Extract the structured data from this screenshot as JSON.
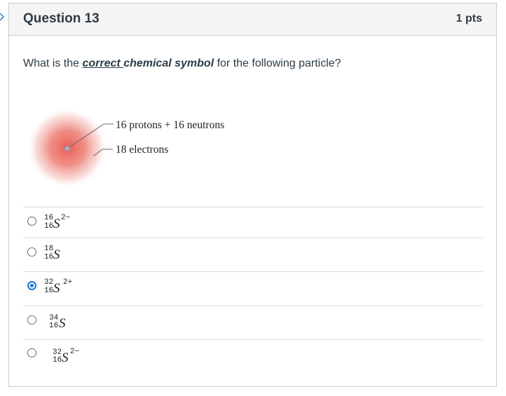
{
  "question": {
    "title": "Question 13",
    "points": "1 pts",
    "prompt_before": "What is the ",
    "prompt_emph_underlined": "correct ",
    "prompt_emph": "chemical symbol",
    "prompt_after": " for the following particle?"
  },
  "figure": {
    "label_nucleus": "16 protons + 16 neutrons",
    "label_electrons": "18 electrons",
    "cloud_color": "#e8564c"
  },
  "answers": [
    {
      "mass": "16",
      "atomic": "16",
      "symbol": "S",
      "charge": "2−",
      "selected": false
    },
    {
      "mass": "18",
      "atomic": "16",
      "symbol": "S",
      "charge": "",
      "selected": false
    },
    {
      "mass": "32",
      "atomic": "16",
      "symbol": "S",
      "charge": "2+",
      "selected": true
    },
    {
      "mass": "34",
      "atomic": "16",
      "symbol": "S",
      "charge": "",
      "selected": false
    },
    {
      "mass": "32",
      "atomic": "16",
      "symbol": "S",
      "charge": "2−",
      "selected": false
    }
  ],
  "colors": {
    "accent": "#1a73e8",
    "header_bg": "#f5f5f5",
    "text": "#2d3b45"
  }
}
